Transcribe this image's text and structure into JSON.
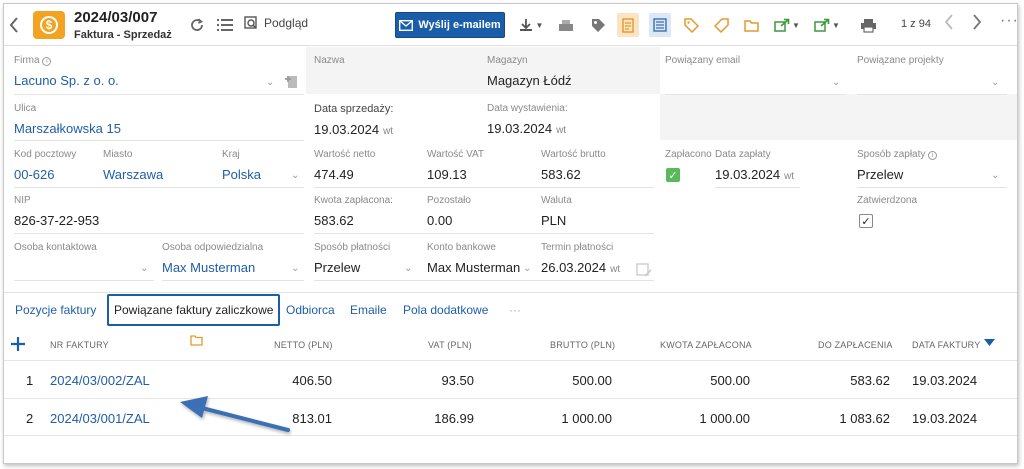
{
  "header": {
    "title": "2024/03/007",
    "subtitle": "Faktura - Sprzedaż",
    "preview_label": "Podgląd",
    "email_label": "Wyślij e-mailem",
    "pager": "1 z 94"
  },
  "colors": {
    "primary": "#1a5da8",
    "doc_icon": "#f3a321",
    "checked_green": "#5cb85c",
    "link": "#1f5ea8",
    "arrow": "#3b6fb5"
  },
  "form": {
    "firma": {
      "label": "Firma",
      "value": "Lacuno Sp. z o. o."
    },
    "nazwa": {
      "label": "Nazwa",
      "value": ""
    },
    "magazyn": {
      "label": "Magazyn",
      "value": "Magazyn Łódź"
    },
    "powiazany_email": {
      "label": "Powiązany email",
      "value": ""
    },
    "powiazane_projekty": {
      "label": "Powiązane projekty",
      "value": ""
    },
    "ulica": {
      "label": "Ulica",
      "value": "Marszałkowska 15"
    },
    "data_sprzedazy": {
      "label": "Data sprzedaży:",
      "value": "19.03.2024",
      "suffix": "wt"
    },
    "data_wystawienia": {
      "label": "Data wystawienia:",
      "value": "19.03.2024",
      "suffix": "wt"
    },
    "kod_pocztowy": {
      "label": "Kod pocztowy",
      "value": "00-626"
    },
    "miasto": {
      "label": "Miasto",
      "value": "Warszawa"
    },
    "kraj": {
      "label": "Kraj",
      "value": "Polska"
    },
    "wartosc_netto": {
      "label": "Wartość netto",
      "value": "474.49"
    },
    "wartosc_vat": {
      "label": "Wartość VAT",
      "value": "109.13"
    },
    "wartosc_brutto": {
      "label": "Wartość brutto",
      "value": "583.62"
    },
    "zaplacono": {
      "label": "Zapłacono",
      "checked": true
    },
    "data_zaplaty": {
      "label": "Data zapłaty",
      "value": "19.03.2024",
      "suffix": "wt"
    },
    "sposob_zaplaty": {
      "label": "Sposób zapłaty",
      "value": "Przelew"
    },
    "nip": {
      "label": "NIP",
      "value": "826-37-22-953"
    },
    "kwota_zaplacona": {
      "label": "Kwota zapłacona:",
      "value": "583.62"
    },
    "pozostalo": {
      "label": "Pozostało",
      "value": "0.00"
    },
    "waluta": {
      "label": "Waluta",
      "value": "PLN"
    },
    "zatwierdzona": {
      "label": "Zatwierdzona",
      "checked": true
    },
    "osoba_kontaktowa": {
      "label": "Osoba kontaktowa",
      "value": ""
    },
    "osoba_odpowiedzialna": {
      "label": "Osoba odpowiedzialna",
      "value": "Max Musterman"
    },
    "sposob_platnosci": {
      "label": "Sposób płatności",
      "value": "Przelew"
    },
    "konto_bankowe": {
      "label": "Konto bankowe",
      "value": "Max Musterman"
    },
    "termin_platnosci": {
      "label": "Termin płatności",
      "value": "26.03.2024",
      "suffix": "wt"
    }
  },
  "tabs": [
    {
      "label": "Pozycje faktury",
      "active": false
    },
    {
      "label": "Powiązane faktury zaliczkowe",
      "active": true
    },
    {
      "label": "Odbiorca",
      "active": false
    },
    {
      "label": "Emaile",
      "active": false
    },
    {
      "label": "Pola dodatkowe",
      "active": false
    },
    {
      "label": "···",
      "active": false
    }
  ],
  "table": {
    "columns": [
      "NR FAKTURY",
      "NETTO (PLN)",
      "VAT (PLN)",
      "BRUTTO (PLN)",
      "KWOTA ZAPŁACONA",
      "DO ZAPŁACENIA",
      "DATA FAKTURY"
    ],
    "rows": [
      {
        "idx": "1",
        "nr": "2024/03/002/ZAL",
        "netto": "406.50",
        "vat": "93.50",
        "brutto": "500.00",
        "kwota": "500.00",
        "do_zaplaty": "583.62",
        "data": "19.03.2024"
      },
      {
        "idx": "2",
        "nr": "2024/03/001/ZAL",
        "netto": "813.01",
        "vat": "186.99",
        "brutto": "1 000.00",
        "kwota": "1 000.00",
        "do_zaplaty": "1 083.62",
        "data": "19.03.2024"
      }
    ]
  }
}
